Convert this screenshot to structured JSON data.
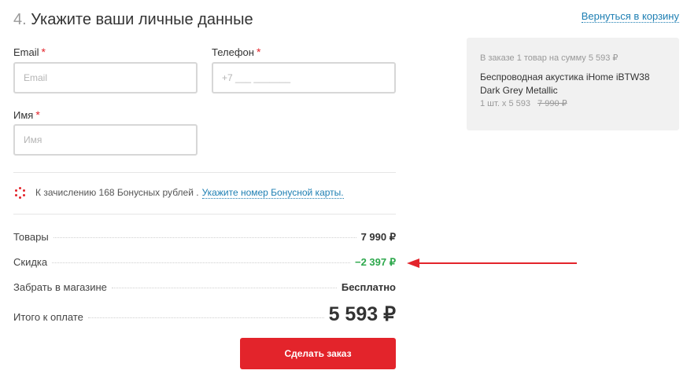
{
  "header": {
    "step_number": "4.",
    "title": "Укажите ваши личные данные",
    "back_link": "Вернуться в корзину"
  },
  "form": {
    "email": {
      "label": "Email",
      "required_mark": "*",
      "placeholder": "Email",
      "value": ""
    },
    "phone": {
      "label": "Телефон",
      "required_mark": "*",
      "placeholder": "+7 ___ _______",
      "value": ""
    },
    "name": {
      "label": "Имя",
      "required_mark": "*",
      "placeholder": "Имя",
      "value": ""
    }
  },
  "bonus": {
    "text": "К зачислению 168 Бонусных рублей .",
    "link": "Укажите номер Бонусной карты."
  },
  "summary": {
    "goods": {
      "label": "Товары",
      "value": "7 990 ₽"
    },
    "discount": {
      "label": "Скидка",
      "value": "−2 397 ₽"
    },
    "delivery": {
      "label": "Забрать в магазине",
      "value": "Бесплатно"
    },
    "total": {
      "label": "Итого к оплате",
      "value": "5 593 ₽"
    }
  },
  "submit": {
    "label": "Сделать заказ"
  },
  "order": {
    "summary": "В заказе 1 товар на сумму 5 593 ₽",
    "product_name": "Беспроводная акустика iHome iBTW38 Dark Grey Metallic",
    "qty_price": "1 шт. x 5 593",
    "old_price": "7 990 ₽"
  },
  "colors": {
    "accent": "#e3242b",
    "link": "#1e7fb3",
    "discount": "#2ea84d"
  },
  "icons": {
    "bonus": "bonus-dots-icon",
    "annotation": "red-arrow-left-icon"
  }
}
